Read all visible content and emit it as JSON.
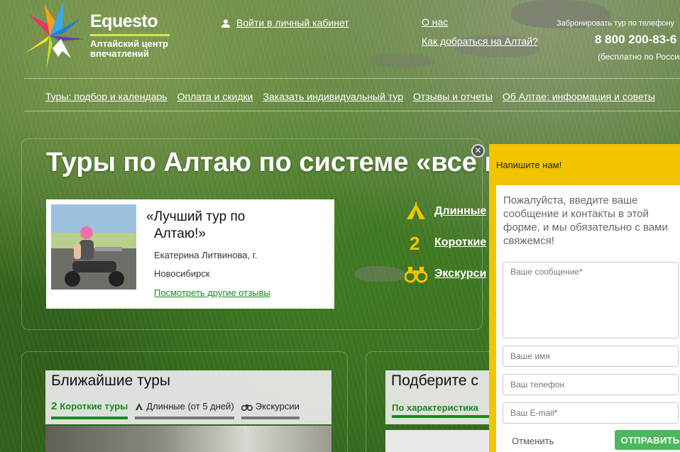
{
  "brand": {
    "name": "Equesto",
    "tagline_line1": "Алтайский центр",
    "tagline_line2": "впечатлений"
  },
  "header": {
    "account_link": "Войти в личный кабинет",
    "about_link": "О нас",
    "directions_link": "Как добраться на Алтай?",
    "phone_caption": "Забронировать тур по телефону",
    "phone_number": "8 800 200-83-6",
    "phone_free": "(бесплатно по России)"
  },
  "nav": [
    {
      "label": "Туры: подбор и календарь"
    },
    {
      "label": "Оплата и скидки"
    },
    {
      "label": "Заказать индивидуальный тур"
    },
    {
      "label": "Отзывы и отчеты"
    },
    {
      "label": "Об Алтае: информация и советы"
    }
  ],
  "page_title": "Туры по Алтаю по системе «все в",
  "review": {
    "quote_line1": "«Лучший тур по",
    "quote_line2": "Алтаю!»",
    "author_line1": "Екатерина Литвинова, г.",
    "author_line2": "Новосибирск",
    "more_link": "Посмотреть другие отзывы"
  },
  "tour_types": [
    {
      "icon": "tent-icon",
      "label": "Длинные"
    },
    {
      "icon": "number-two-icon",
      "label": "Короткие"
    },
    {
      "icon": "binoculars-icon",
      "label": "Экскурси"
    }
  ],
  "nearest_tours": {
    "title": "Ближайшие туры",
    "tabs": [
      {
        "prefix": "2",
        "label": "Короткие туры",
        "active": true
      },
      {
        "prefix": "",
        "label": "Длинные (от 5 дней)",
        "active": false
      },
      {
        "prefix": "",
        "label": "Экскурсии",
        "active": false
      }
    ]
  },
  "picker": {
    "title": "Подберите с",
    "tab": "По характеристика"
  },
  "contact_widget": {
    "close_glyph": "✕",
    "header": "Напишите нам!",
    "intro": "Пожалуйста, введите ваше сообщение и контакты в этой форме, и мы обязательно с вами свяжемся!",
    "message_placeholder": "Ваше сообщение*",
    "name_placeholder": "Ваше имя",
    "phone_placeholder": "Ваш телефон",
    "email_placeholder": "Ваш E-mail*",
    "cancel_label": "Отменить",
    "send_label": "ОТПРАВИТЬ"
  },
  "colors": {
    "accent_green": "#1a8a1a",
    "widget_yellow": "#f2c400",
    "send_green": "#4cb85c",
    "icon_yellow": "#f2c400"
  }
}
